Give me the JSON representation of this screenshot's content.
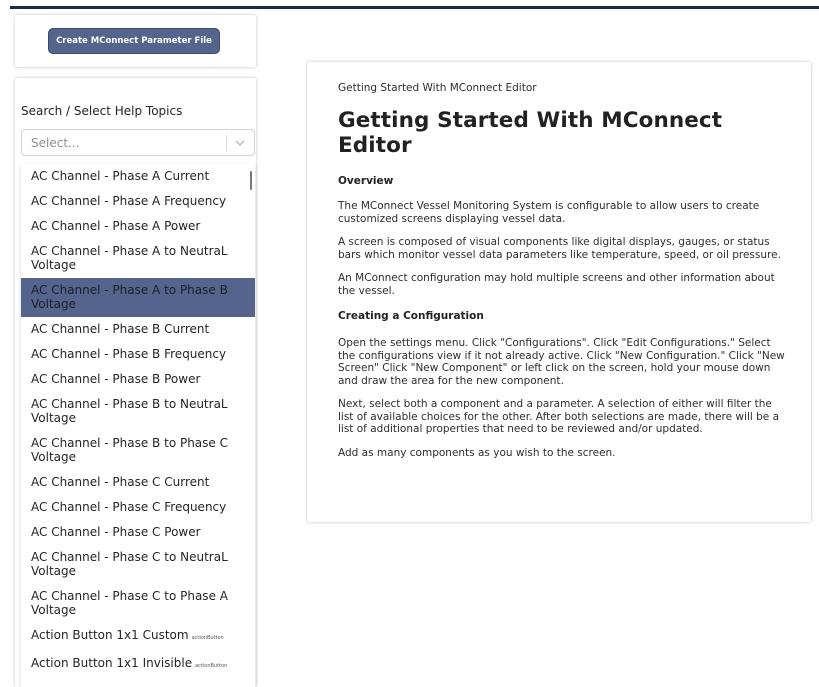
{
  "create_button": {
    "label": "Create MConnect Parameter File"
  },
  "search": {
    "label": "Search / Select Help Topics",
    "placeholder": "Select..."
  },
  "topics": [
    {
      "label": "AC Channel - Phase A Current",
      "selected": false
    },
    {
      "label": "AC Channel - Phase A Frequency",
      "selected": false
    },
    {
      "label": "AC Channel - Phase A Power",
      "selected": false
    },
    {
      "label": "AC Channel - Phase A to NeutraL Voltage",
      "selected": false
    },
    {
      "label": "AC Channel - Phase A to Phase B Voltage",
      "selected": true
    },
    {
      "label": "AC Channel - Phase B Current",
      "selected": false
    },
    {
      "label": "AC Channel - Phase B Frequency",
      "selected": false
    },
    {
      "label": "AC Channel - Phase B Power",
      "selected": false
    },
    {
      "label": "AC Channel - Phase B to NeutraL Voltage",
      "selected": false
    },
    {
      "label": "AC Channel - Phase B to Phase C Voltage",
      "selected": false
    },
    {
      "label": "AC Channel - Phase C Current",
      "selected": false
    },
    {
      "label": "AC Channel - Phase C Frequency",
      "selected": false
    },
    {
      "label": "AC Channel - Phase C Power",
      "selected": false
    },
    {
      "label": "AC Channel - Phase C to NeutraL Voltage",
      "selected": false
    },
    {
      "label": "AC Channel - Phase C to Phase A Voltage",
      "selected": false
    },
    {
      "label": "Action Button 1x1 Custom",
      "tag": "actionButton",
      "selected": false
    },
    {
      "label": "Action Button 1x1 Invisible",
      "tag": "actionButton",
      "selected": false
    }
  ],
  "content": {
    "breadcrumb": "Getting Started With MConnect Editor",
    "title": "Getting Started With MConnect Editor",
    "overview_heading": "Overview",
    "overview_p1": "The MConnect Vessel Monitoring System is configurable to allow users to create customized screens displaying vessel data.",
    "overview_p2": "A screen is composed of visual components like digital displays, gauges, or status bars which monitor vessel data parameters like temperature, speed, or oil pressure.",
    "overview_p3": "An MConnect configuration may hold multiple screens and other information about the vessel.",
    "config_heading": "Creating a Configuration",
    "config_p1": "Open the settings menu. Click \"Configurations\". Click \"Edit Configurations.\" Select the configurations view if it not already active. Click \"New Configuration.\" Click \"New Screen\" Click \"New Component\" or left click on the screen, hold your mouse down and draw the area for the new component.",
    "config_p2": "Next, select both a component and a parameter. A selection of either will filter the list of available choices for the other. After both selections are made, there will be a list of additional properties that need to be reviewed and/or updated.",
    "config_p3": "Add as many components as you wish to the screen."
  },
  "colors": {
    "accent": "#55648c",
    "top_bar": "#1b2a45"
  },
  "icons": {
    "select_caret": "chevron-down-icon"
  }
}
